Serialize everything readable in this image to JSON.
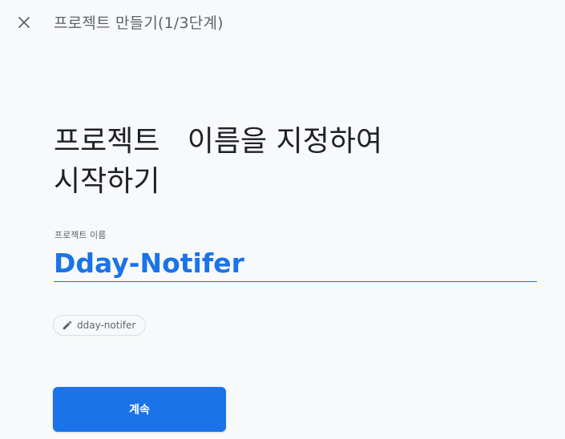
{
  "header": {
    "close_icon": "close-icon",
    "step_title": "프로젝트 만들기(1/3단계)"
  },
  "main": {
    "headline_line1": "프로젝트   이름을 지정하여",
    "headline_line2": "시작하기",
    "project_name_label": "프로젝트 이름",
    "project_name_value": "Dday-Notifer",
    "project_id_icon": "pencil-icon",
    "project_id": "dday-notifer",
    "continue_label": "계속"
  },
  "colors": {
    "accent": "#1a73e8",
    "background": "#f8f9fa",
    "text_primary": "#202124",
    "text_secondary": "#5f6368"
  }
}
